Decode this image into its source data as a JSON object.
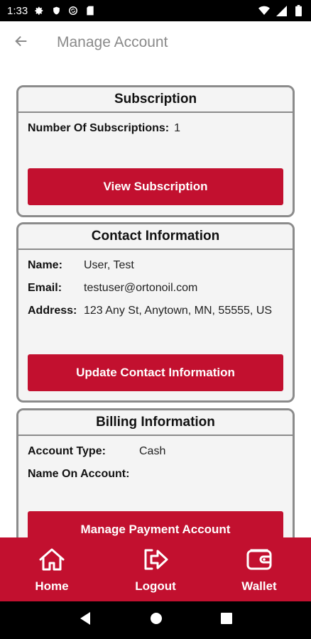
{
  "status_bar": {
    "time": "1:33",
    "icons_left": [
      "gear-icon",
      "shield-icon",
      "sync-icon",
      "sd-card-icon"
    ],
    "icons_right": [
      "wifi-icon",
      "signal-icon",
      "battery-icon"
    ]
  },
  "app_bar": {
    "back_icon": "arrow-left-icon",
    "title": "Manage Account"
  },
  "subscription": {
    "header": "Subscription",
    "count_label": "Number Of Subscriptions:",
    "count_value": "1",
    "button_label": "View Subscription"
  },
  "contact": {
    "header": "Contact Information",
    "name_label": "Name:",
    "name_value": "User, Test",
    "email_label": "Email:",
    "email_value": "testuser@ortonoil.com",
    "address_label": "Address:",
    "address_value": "123 Any St, Anytown, MN, 55555, US",
    "button_label": "Update Contact Information"
  },
  "billing": {
    "header": "Billing Information",
    "account_type_label": "Account Type:",
    "account_type_value": "Cash",
    "name_on_account_label": "Name On Account:",
    "name_on_account_value": "",
    "button_label": "Manage Payment Account"
  },
  "bottom_nav": {
    "items": [
      {
        "label": "Home",
        "icon": "home-icon"
      },
      {
        "label": "Logout",
        "icon": "logout-icon"
      },
      {
        "label": "Wallet",
        "icon": "wallet-icon"
      }
    ]
  },
  "colors": {
    "accent": "#c2102f",
    "card_border": "#8b8b8b",
    "card_bg": "#f4f4f4"
  }
}
